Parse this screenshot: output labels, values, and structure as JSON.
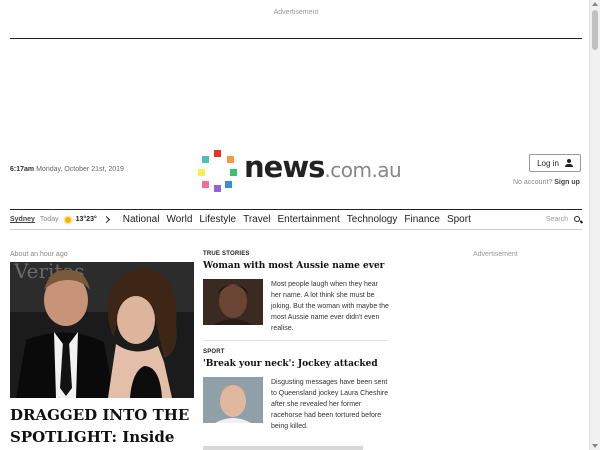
{
  "top_ad": {
    "label": "Advertisement"
  },
  "header": {
    "time": "6:17am",
    "date": "Monday, October 21st, 2019",
    "logo": {
      "wordmark": "news",
      "domain": ".com.au",
      "dot_colors": [
        "#e3342f",
        "#f6993f",
        "#38c172",
        "#3490dc",
        "#9561e2",
        "#f66d9b",
        "#ffed4a",
        "#4dc0b5"
      ]
    },
    "login": {
      "label": "Log in",
      "icon": "user-icon"
    },
    "no_account": {
      "prompt": "No account?",
      "signup": "Sign up"
    }
  },
  "nav": {
    "weather": {
      "city": "Sydney",
      "today": "Today",
      "icon": "sun-icon",
      "temps": "13°23°"
    },
    "items": [
      "National",
      "World",
      "Lifestyle",
      "Travel",
      "Entertainment",
      "Technology",
      "Finance",
      "Sport"
    ],
    "search_label": "Search"
  },
  "hero": {
    "time": "About an hour ago",
    "headline": "DRAGGED INTO THE SPOTLIGHT: Inside",
    "image_text": "Veritas"
  },
  "stories": [
    {
      "category": "TRUE STORIES",
      "headline": "Woman with most Aussie name ever",
      "excerpt": "Most people laugh when they hear her name. A lot think she must be joking. But the woman with maybe the most Aussie name ever didn't even realise."
    },
    {
      "category": "SPORT",
      "headline": "'Break your neck': Jockey attacked",
      "excerpt": "Disgusting messages have been sent to Queensland jockey Laura Cheshire after she revealed her former racehorse had been tortured before being killed."
    }
  ],
  "right_ad": {
    "label": "Advertisement"
  },
  "colors": {
    "accent": "#222222",
    "link": "#444444"
  }
}
